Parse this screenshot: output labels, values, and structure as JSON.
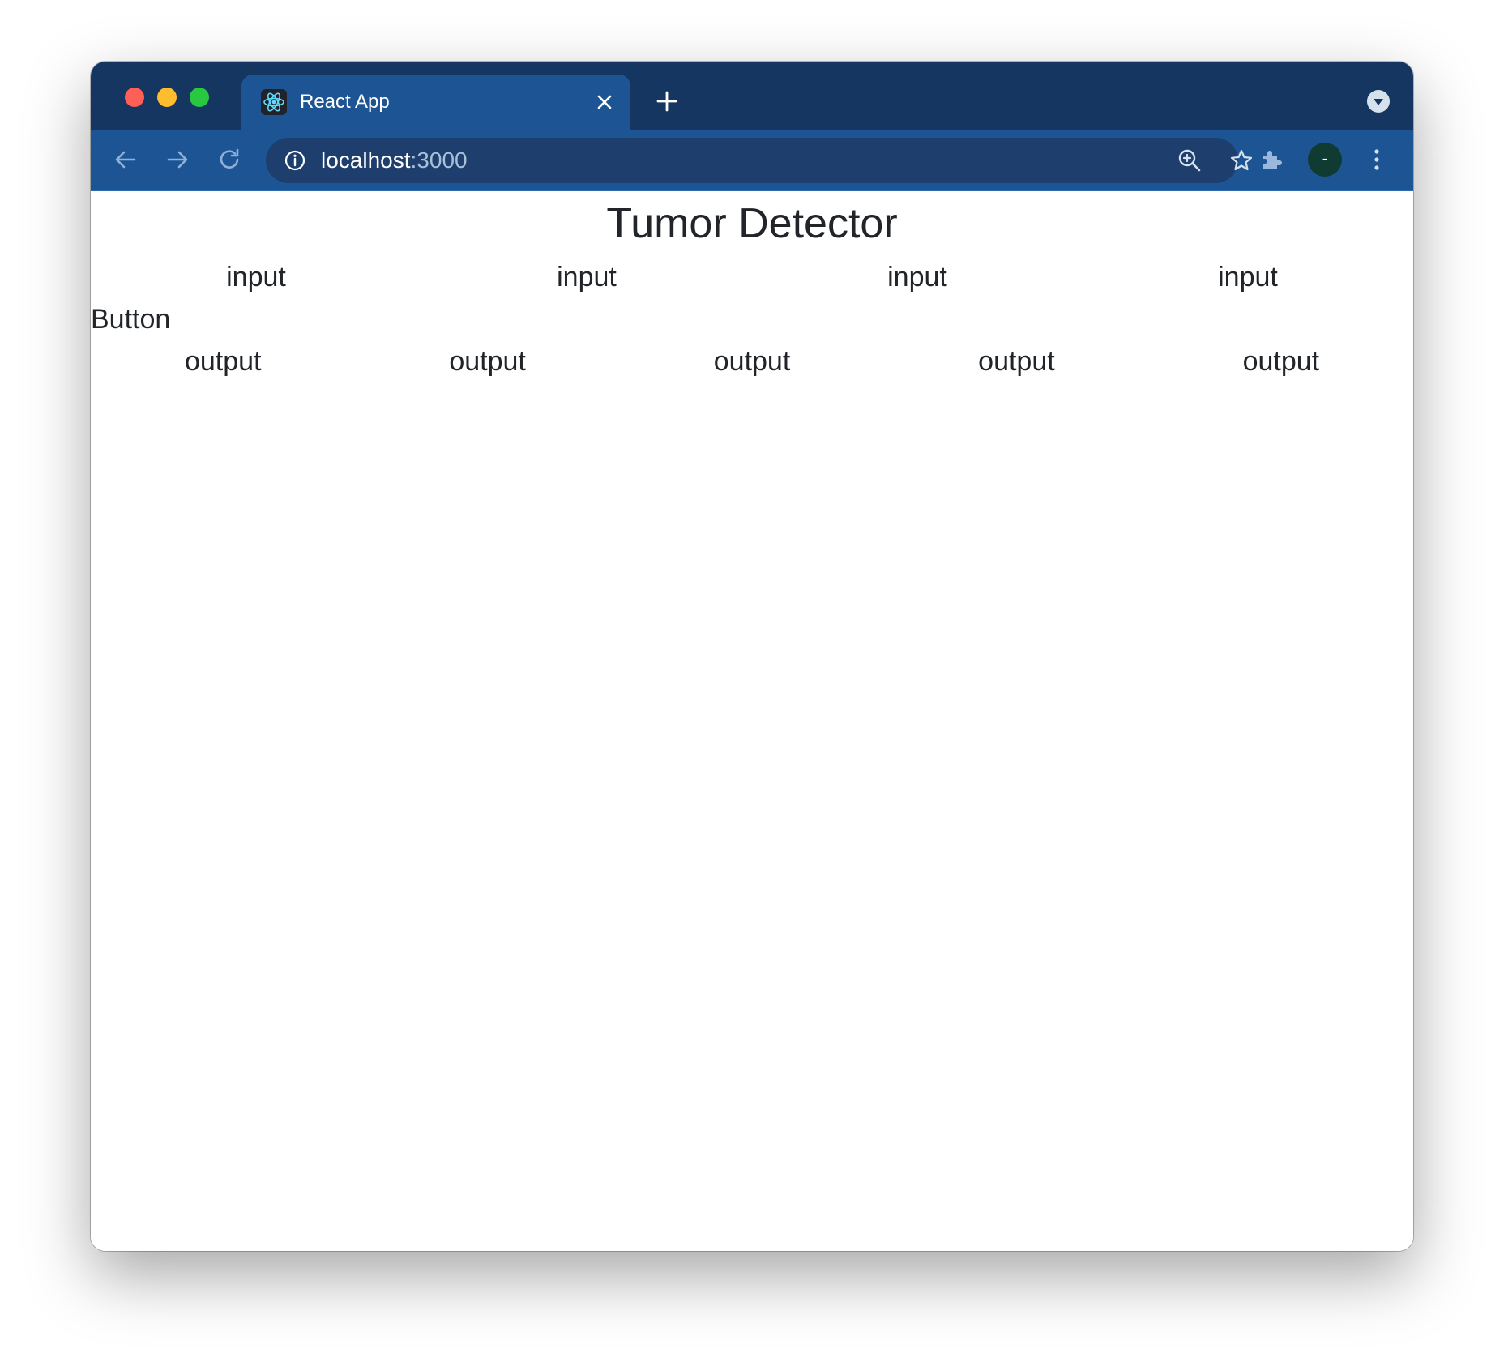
{
  "colors": {
    "titlebar": "#143660",
    "toolbar": "#1d5594",
    "omnibox": "#1e3f6e",
    "traffic_close": "#fe5f57",
    "traffic_min": "#febc2e",
    "traffic_max": "#28c840",
    "page_text": "#212529"
  },
  "browser": {
    "tab": {
      "title": "React App",
      "favicon": "react-logo-icon"
    },
    "address": {
      "host": "localhost",
      "port": ":3000"
    },
    "profile_initial": "-"
  },
  "page": {
    "title": "Tumor Detector",
    "inputs": [
      "input",
      "input",
      "input",
      "input"
    ],
    "button_label": "Button",
    "outputs": [
      "output",
      "output",
      "output",
      "output",
      "output"
    ]
  }
}
